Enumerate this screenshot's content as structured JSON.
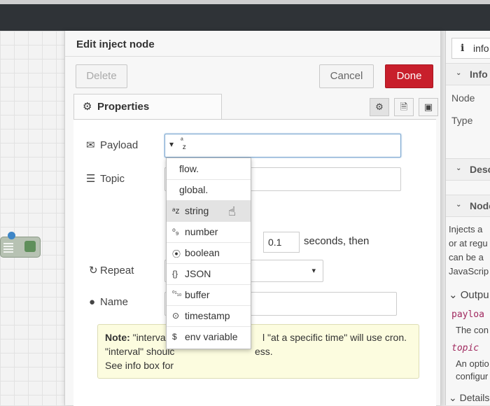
{
  "dialog": {
    "title": "Edit inject node",
    "delete_label": "Delete",
    "cancel_label": "Cancel",
    "done_label": "Done",
    "done_color": "#c81f2c"
  },
  "tabs": {
    "properties_label": "Properties",
    "icons": [
      "gear-icon",
      "description-icon",
      "appearance-icon"
    ]
  },
  "form": {
    "payload_label": "Payload",
    "payload_type_glyph": "a\nz",
    "topic_label": "Topic",
    "interval_value": "0.1",
    "seconds_text": "seconds, then",
    "repeat_label": "Repeat",
    "name_label": "Name"
  },
  "note": {
    "bold": "Note:",
    "line1a": "\"interval l",
    "line1b": "l \"at a specific time\" will use cron.",
    "line2a": "\"interval\" shoulc",
    "line2b": "ess.",
    "line3": "See info box for"
  },
  "dropdown": {
    "items": [
      {
        "glyph": "",
        "label": "flow."
      },
      {
        "glyph": "",
        "label": "global."
      },
      {
        "glyph": "ᵃz",
        "label": "string"
      },
      {
        "glyph": "⁰₉",
        "label": "number"
      },
      {
        "glyph": "⦿",
        "label": "boolean"
      },
      {
        "glyph": "{}",
        "label": "JSON"
      },
      {
        "glyph": "⁰¹₁₀",
        "label": "buffer"
      },
      {
        "glyph": "⊙",
        "label": "timestamp"
      },
      {
        "glyph": "$",
        "label": "env variable"
      }
    ],
    "hovered": "string"
  },
  "sidebar": {
    "tab_icon": "i",
    "tab_label": "info",
    "info_head": "Info",
    "node_label": "Node",
    "type_label": "Type",
    "desc_head": "Desc",
    "node_head": "Node",
    "text1": "Injects a",
    "text2": "or at regu",
    "text3": "can be a",
    "text4": "JavaScrip",
    "outputs_head": "Outpu",
    "payload_code": "payloa",
    "payload_desc": "The con",
    "topic_code": "topic",
    "topic_desc1": "An optio",
    "topic_desc2": "configur",
    "details_head": "Details"
  }
}
